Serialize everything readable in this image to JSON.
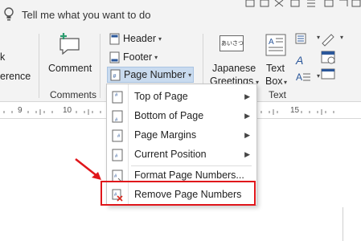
{
  "tellme": {
    "text": "Tell me what you want to do"
  },
  "ribbon": {
    "left_partial": {
      "line1": "k",
      "line2": "erence"
    },
    "comment_label": "Comment",
    "comments_group": "Comments",
    "header_label": "Header",
    "footer_label": "Footer",
    "pagenumber_label": "Page Number",
    "japanese_line1": "Japanese",
    "japanese_line2": "Greetings",
    "japanese_icon_text": "あいさつ",
    "textbox_line1": "Text",
    "textbox_line2": "Box",
    "text_group": "Text"
  },
  "ruler": {
    "labels": [
      "9",
      "10",
      "15"
    ]
  },
  "menu": {
    "items": [
      {
        "label": "Top of Page",
        "has_submenu": true
      },
      {
        "label": "Bottom of Page",
        "has_submenu": true
      },
      {
        "label": "Page Margins",
        "has_submenu": true
      },
      {
        "label": "Current Position",
        "has_submenu": true
      },
      {
        "label": "Format Page Numbers...",
        "has_submenu": false
      },
      {
        "label": "Remove Page Numbers",
        "has_submenu": false
      }
    ]
  },
  "colors": {
    "highlight": "#e0161b",
    "selected_button_bg": "#c9dbef",
    "ribbon_bg": "#f3f3f3"
  }
}
